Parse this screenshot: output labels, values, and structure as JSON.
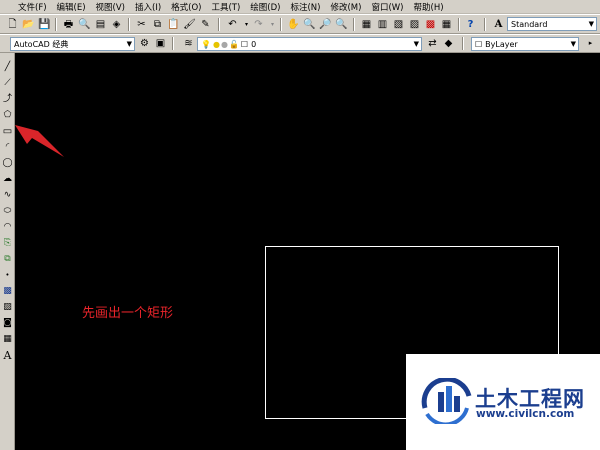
{
  "menu": [
    "文件(F)",
    "编辑(E)",
    "视图(V)",
    "插入(I)",
    "格式(O)",
    "工具(T)",
    "绘图(D)",
    "标注(N)",
    "修改(M)",
    "窗口(W)",
    "帮助(H)"
  ],
  "text_style": {
    "value": "Standard"
  },
  "workspace": {
    "value": "AutoCAD 经典"
  },
  "layer": {
    "name": "0"
  },
  "color_control": {
    "value": "ByLayer"
  },
  "drawing": {
    "caption": "先画出一个矩形"
  },
  "watermark": {
    "name": "土木工程网",
    "url": "www.civilcn.com"
  },
  "colors": {
    "caption": "#e8242a",
    "arrow": "#d9252a",
    "watermark_blue": "#1b3e8f"
  }
}
